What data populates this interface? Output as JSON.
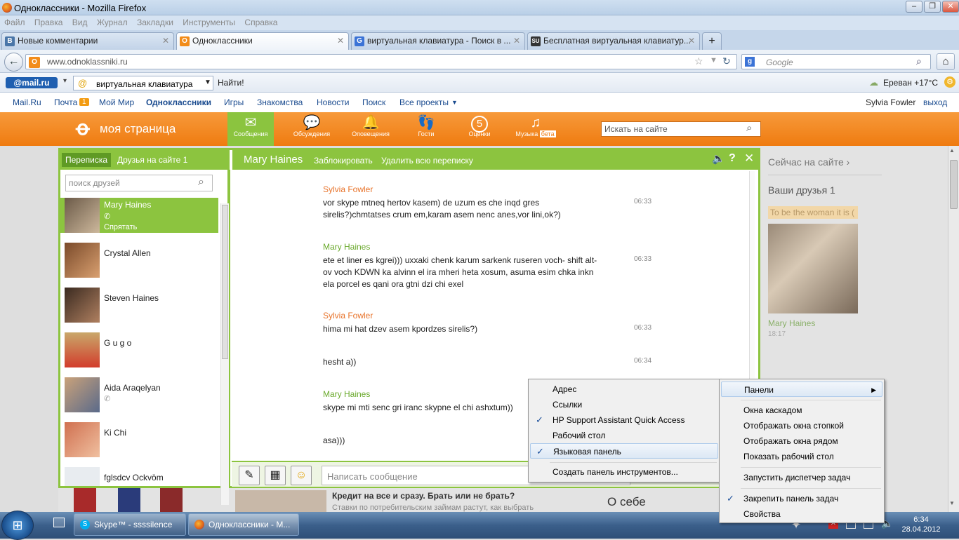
{
  "window": {
    "title": "Одноклассники - Mozilla Firefox"
  },
  "menubar": [
    "Файл",
    "Правка",
    "Вид",
    "Журнал",
    "Закладки",
    "Инструменты",
    "Справка"
  ],
  "tabs": [
    {
      "label": "Новые комментарии",
      "fav": "В"
    },
    {
      "label": "Одноклассники",
      "fav": "О"
    },
    {
      "label": "виртуальная клавиатура - Поиск в ...",
      "fav": "G"
    },
    {
      "label": "Бесплатная виртуальная клавиатур...",
      "fav": "SU"
    }
  ],
  "nav": {
    "url": "www.odnoklassniki.ru",
    "search_placeholder": "Google"
  },
  "mailbar": {
    "logo": "@mail.ru",
    "query": "виртуальная клавиатура",
    "find": "Найти!",
    "weather": "Ереван +17°C"
  },
  "portal": {
    "links": [
      "Mail.Ru",
      "Почта",
      "Мой Мир",
      "Одноклассники",
      "Игры",
      "Знакомства",
      "Новости",
      "Поиск",
      "Все проекты"
    ],
    "mail_count": "1",
    "user": "Sylvia Fowler",
    "logout": "выход"
  },
  "ok": {
    "brand": "моя страница",
    "nav": [
      "Сообщения",
      "Обсуждения",
      "Оповещения",
      "Гости",
      "Оценки",
      "Музыка"
    ],
    "grades_badge": "5",
    "music_badge": "бета",
    "search_placeholder": "Искать на сайте"
  },
  "chat": {
    "tab_conversations": "Переписка",
    "tab_online": "Друзья на сайте 1",
    "partner": "Mary Haines",
    "block": "Заблокировать",
    "delete_all": "Удалить всю переписку",
    "friend_search": "поиск друзей",
    "hide": "Спрятать",
    "friends": [
      "Mary Haines",
      "Crystal Allen",
      "Steven Haines",
      "G u g o",
      "Aida Araqelyan",
      "Ki Chi",
      "fglsdcv Ockvöm"
    ],
    "messages": [
      {
        "author": "Sylvia Fowler",
        "text": "vor skype mtneq hertov kasem) de uzum es che inqd gres sirelis?)chmtatses crum em,karam asem nenc anes,vor lini,ok?)",
        "time": "06:33"
      },
      {
        "author": "Mary Haines",
        "text": "ete et liner es kgrei))) uxxaki chenk karum sarkenk ruseren voch- shift alt-ov voch KDWN ka alvinn el ira mheri heta xosum, asuma esim chka inkn ela porcel es qani ora gtni dzi chi exel",
        "time": "06:33"
      },
      {
        "author": "Sylvia Fowler",
        "text": "hima mi hat dzev asem kpordzes sirelis?)",
        "time": "06:33"
      },
      {
        "author": "",
        "text": "hesht a))",
        "time": "06:34"
      },
      {
        "author": "Mary Haines",
        "text": "skype mi mti senc gri iranc skypne el chi ashxtum))",
        "time": ""
      },
      {
        "author": "",
        "text": "asa)))",
        "time": ""
      }
    ],
    "compose_placeholder": "Написать сообщение"
  },
  "sidebar": {
    "online_now": "Сейчас на сайте ›",
    "your_friends": "Ваши друзья 1",
    "status": "To be the woman it is (",
    "friend_name": "Mary Haines",
    "friend_time": "18:17"
  },
  "ad": {
    "title": "Кредит на все и сразу. Брать или не брать?",
    "text": "Ставки по потребительским займам растут, как выбрать",
    "about": "О себе"
  },
  "panels_menu": [
    {
      "label": "Адрес",
      "checked": false
    },
    {
      "label": "Ссылки",
      "checked": false
    },
    {
      "label": "HP Support Assistant Quick Access",
      "checked": true
    },
    {
      "label": "Рабочий стол",
      "checked": false
    },
    {
      "label": "Языковая панель",
      "checked": true
    },
    {
      "label": "Создать панель инструментов...",
      "checked": false
    }
  ],
  "taskbar_menu": [
    {
      "label": "Панели",
      "checked": false
    },
    {
      "label": "Окна каскадом",
      "checked": false
    },
    {
      "label": "Отображать окна стопкой",
      "checked": false
    },
    {
      "label": "Отображать окна рядом",
      "checked": false
    },
    {
      "label": "Показать рабочий стол",
      "checked": false
    },
    {
      "label": "Запустить диспетчер задач",
      "checked": false
    },
    {
      "label": "Закрепить панель задач",
      "checked": true
    },
    {
      "label": "Свойства",
      "checked": false
    }
  ],
  "taskbar": {
    "items": [
      "Skype™ - ssssilence",
      "Одноклассники - M..."
    ],
    "time": "6:34",
    "date": "28.04.2012"
  },
  "colors": {
    "ok_orange": "#ef7b10",
    "ok_green": "#8cc43f",
    "author_orange": "#e8732a",
    "author_green": "#6aa92c"
  }
}
